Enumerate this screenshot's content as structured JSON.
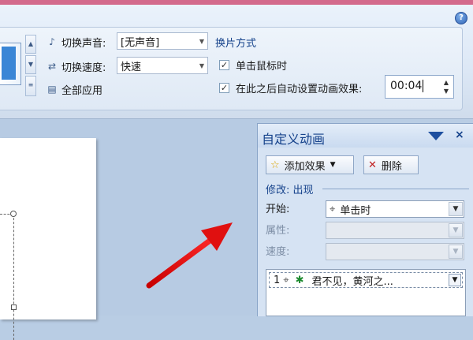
{
  "ribbon": {
    "transition_sound_label": "切换声音:",
    "transition_sound_value": "[无声音]",
    "transition_speed_label": "切换速度:",
    "transition_speed_value": "快速",
    "apply_all_label": "全部应用",
    "advance_group_label": "换片方式",
    "on_click_label": "单击鼠标时",
    "on_click_checked": "✓",
    "auto_after_label": "在此之后自动设置动画效果:",
    "auto_after_checked": "✓",
    "auto_after_time": "00:04",
    "help_icon": "?"
  },
  "pane": {
    "title": "自定义动画",
    "close": "×",
    "add_effect_label": "添加效果",
    "delete_label": "删除",
    "modify_label": "修改: 出现",
    "start_label": "开始:",
    "start_value": "单击时",
    "property_label": "属性:",
    "speed_label": "速度:",
    "list": [
      {
        "index": "1",
        "text": "君不见，黄河之..."
      }
    ]
  },
  "colors": {
    "accent": "#15428b",
    "arrow": "#e01010"
  },
  "icons": {
    "sound": "speaker-icon",
    "speed": "speed-icon",
    "apply_all": "apply-all-icon",
    "add_effect": "star-effect-icon",
    "delete": "delete-icon",
    "mouse": "mouse-icon",
    "effect": "green-star-icon"
  }
}
